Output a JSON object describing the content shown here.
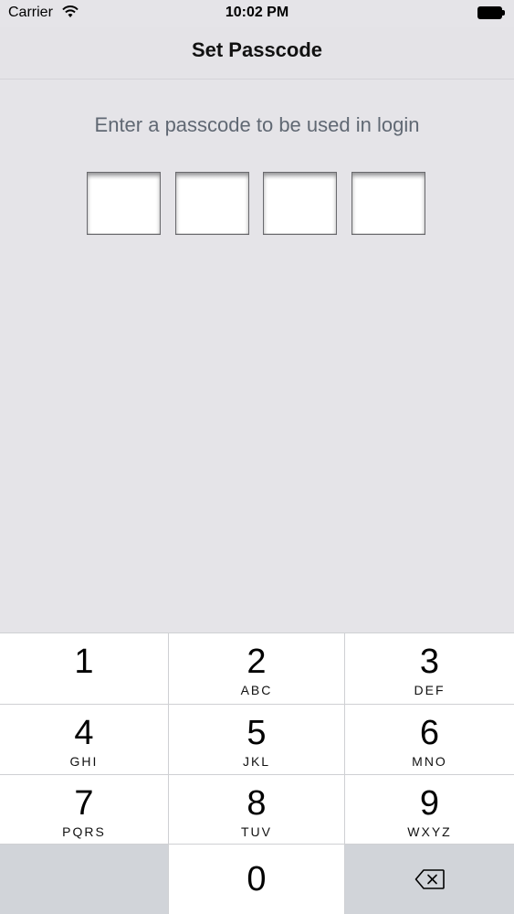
{
  "status_bar": {
    "carrier": "Carrier",
    "time": "10:02 PM",
    "icons": [
      "wifi-icon",
      "battery-icon"
    ]
  },
  "nav": {
    "title": "Set Passcode"
  },
  "content": {
    "prompt": "Enter a passcode to be used in login",
    "code_boxes": [
      "",
      "",
      "",
      ""
    ]
  },
  "keypad": {
    "keys": [
      {
        "digit": "1",
        "letters": ""
      },
      {
        "digit": "2",
        "letters": "ABC"
      },
      {
        "digit": "3",
        "letters": "DEF"
      },
      {
        "digit": "4",
        "letters": "GHI"
      },
      {
        "digit": "5",
        "letters": "JKL"
      },
      {
        "digit": "6",
        "letters": "MNO"
      },
      {
        "digit": "7",
        "letters": "PQRS"
      },
      {
        "digit": "8",
        "letters": "TUV"
      },
      {
        "digit": "9",
        "letters": "WXYZ"
      },
      {
        "digit": "0",
        "letters": ""
      }
    ],
    "backspace_icon": "backspace-icon"
  }
}
